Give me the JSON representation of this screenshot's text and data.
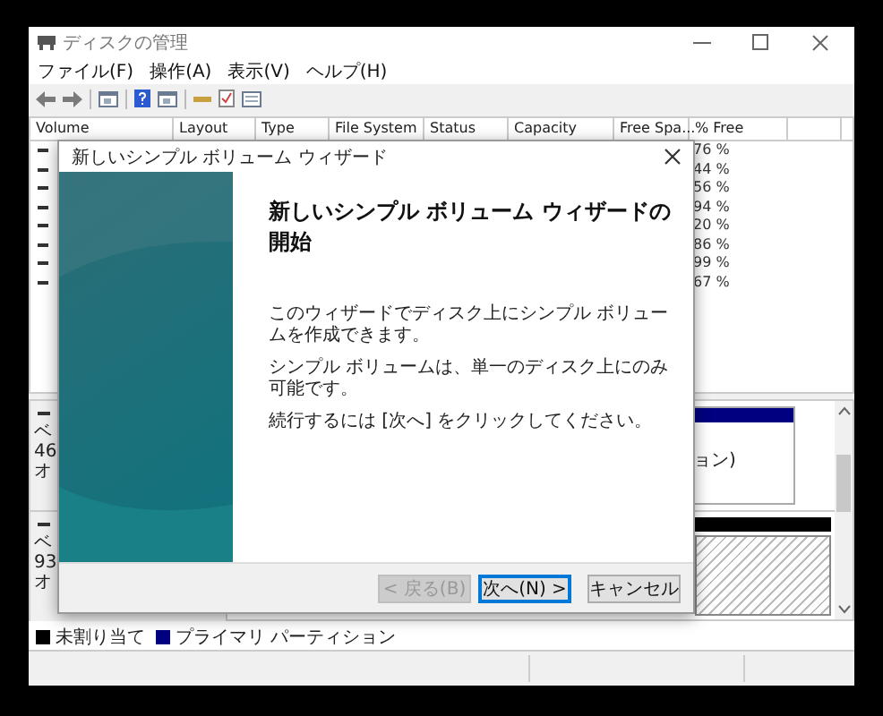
{
  "window": {
    "title": "ディスクの管理"
  },
  "menu": [
    "ファイル(F)",
    "操作(A)",
    "表示(V)",
    "ヘルプ(H)"
  ],
  "table": {
    "columns": [
      "Volume",
      "Layout",
      "Type",
      "File System",
      "Status",
      "Capacity",
      "Free Spa...",
      "% Free"
    ],
    "rows": [
      {
        "percent_free": "76 %"
      },
      {
        "percent_free": "44 %"
      },
      {
        "percent_free": "56 %"
      },
      {
        "percent_free": "94 %"
      },
      {
        "percent_free": "20 %"
      },
      {
        "percent_free": "86 %"
      },
      {
        "percent_free": "99 %"
      },
      {
        "percent_free": "67 %"
      }
    ]
  },
  "disks": [
    {
      "label_lines": [
        "ベ",
        "46",
        "オ"
      ],
      "partition": {
        "kind": "primary",
        "text": "ョン)"
      }
    },
    {
      "label_lines": [
        "ベ",
        "93",
        "オ"
      ],
      "partition": {
        "kind": "unallocated"
      }
    }
  ],
  "legend": [
    {
      "label": "未割り当て",
      "color": "#000000"
    },
    {
      "label": "プライマリ パーティション",
      "color": "#000080"
    }
  ],
  "dialog": {
    "title": "新しいシンプル ボリューム ウィザード",
    "heading": "新しいシンプル ボリューム ウィザードの開始",
    "paragraphs": [
      "このウィザードでディスク上にシンプル ボリュームを作成できます。",
      "シンプル ボリュームは、単一のディスク上にのみ可能です。",
      "続行するには [次へ] をクリックしてください。"
    ],
    "buttons": [
      {
        "label": "< 戻る(B)",
        "disabled": true,
        "default": false
      },
      {
        "label": "次へ(N) >",
        "disabled": false,
        "default": true
      },
      {
        "label": "キャンセル",
        "disabled": false,
        "default": false
      }
    ]
  }
}
